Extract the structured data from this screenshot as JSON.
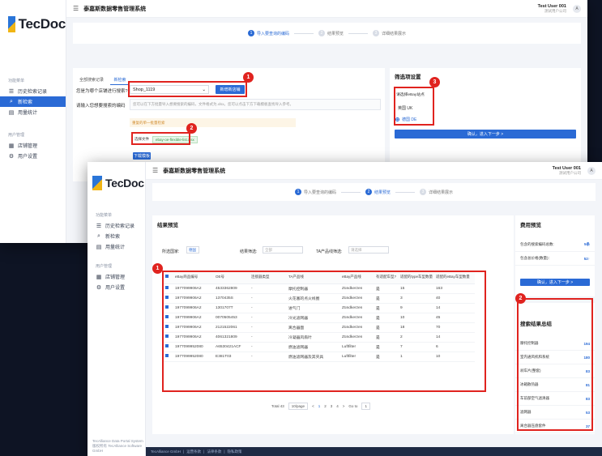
{
  "brand": {
    "logo_text": "TecDoc",
    "footer_line1": "TecAlliance Data Portal System",
    "footer_line2": "版权所有 TecAlliance Software GmbH"
  },
  "topbar": {
    "app_title": "泰嘉斯数据零售管理系统",
    "user_name": "Test User 001",
    "user_org": "测试用户公司",
    "avatar": "A"
  },
  "nav": {
    "group1": "功能菜单",
    "items1": [
      "历史检索记录",
      "新检索",
      "用量统计"
    ],
    "group2": "用户管理",
    "items2": [
      "店铺管理",
      "用户设置"
    ]
  },
  "steps": [
    {
      "num": "1",
      "label": "导入要查询的编码"
    },
    {
      "num": "2",
      "label": "结果预览"
    },
    {
      "num": "3",
      "label": "详细结果展示"
    }
  ],
  "window1": {
    "tabs": [
      "全部搜索记录",
      "新检索"
    ],
    "label_search": "您是为哪个店铺进行搜索?",
    "shop_value": "Shop_1119",
    "btn_add_shop": "新增新店铺",
    "label_codes": "请输入您想要搜索的编码",
    "codes_hint": "您可以在下方批量导入想要搜索的编码，文件格式为.xlsx。您可以点击下方下载模板查找导入参考。",
    "warn": "重复的单一批量检索",
    "upload_label": "选择文件",
    "upload_file": "ebay-oe-flexible-list.xlsx",
    "btn_download": "下载模板",
    "filter_title": "筛选项设置",
    "filter_site_label": "请选择eBay站点",
    "site_uk": "英国 UK",
    "site_de": "德国 DE",
    "btn_confirm": "确认，进入下一步 >",
    "badges": [
      "1",
      "2",
      "3"
    ]
  },
  "window2": {
    "section_title": "结果预览",
    "filter_country_label": "所选国家:",
    "filter_country_value": "德国",
    "filter_result_label": "结果筛选:",
    "filter_result_value": "全部",
    "filter_ta_label": "TA产品线筛选:",
    "filter_ta_value": "请选择",
    "columns": [
      "eBay商品编号",
      "OE号",
      "连接器类型",
      "TA产品线",
      "eBay产品线",
      "有适配车型?",
      "适配的type车型数量",
      "适配的eBay车型数量"
    ],
    "rows": [
      [
        "1977099906A2",
        "4533362809",
        "-",
        "摩托控制器",
        "Zündkerzen",
        "是",
        "15",
        "163"
      ],
      [
        "1977099906A2",
        "1370435S",
        "-",
        "火花塞的点火线圈",
        "Zündkerzen",
        "是",
        "3",
        "40"
      ],
      [
        "1977099906A2",
        "1301707T",
        "-",
        "进气门",
        "Zündkerzen",
        "是",
        "9",
        "14"
      ],
      [
        "1977099906A2",
        "0070505453",
        "-",
        "冷光滤网器",
        "Zündkerzen",
        "是",
        "10",
        "45"
      ],
      [
        "1977099906A2",
        "2121522061",
        "-",
        "离合器面",
        "Zündkerzen",
        "是",
        "18",
        "70"
      ],
      [
        "1977099906A2",
        "4061321809",
        "-",
        "冷凝器风扇叶",
        "Zündkerzen",
        "是",
        "2",
        "14"
      ],
      [
        "1977099952080",
        "A6530421ACF",
        "-",
        "燃油滤网器",
        "Luftfilter",
        "是",
        "7",
        "6"
      ],
      [
        "1977099952080",
        "E381T03",
        "-",
        "燃油滤网器及其夹具",
        "Luftfilter",
        "是",
        "1",
        "10"
      ]
    ],
    "pager": {
      "total": "Total 43",
      "per_page": "10/page",
      "prev": "<",
      "pages": [
        "1",
        "2",
        "3",
        "4"
      ],
      "next": ">",
      "goto": "Go to",
      "goto_value": "1"
    },
    "cost_title": "费用预览",
    "cost_rows": [
      {
        "label": "包含的搜索编码总数:",
        "value": "5条"
      },
      {
        "label": "包含总价格(数量)：",
        "value": "52↑"
      }
    ],
    "btn_confirm": "确认，进入下一步 >",
    "stats_title": "搜索结果总结",
    "stats": [
      {
        "label": "摩托控制器",
        "value": "194"
      },
      {
        "label": "室内通风机和系统",
        "value": "180"
      },
      {
        "label": "刹车片(整套)",
        "value": "83"
      },
      {
        "label": "冰箱散热器",
        "value": "81"
      },
      {
        "label": "车前部空气滤清器",
        "value": "83"
      },
      {
        "label": "滤网器",
        "value": "53"
      },
      {
        "label": "离合器压盘套件",
        "value": "37"
      }
    ],
    "bottom_links": [
      "TecAlliance GmbH",
      "|",
      "运营条款",
      "|",
      "法律条款",
      "|",
      "隐私政策"
    ],
    "badges": [
      "1",
      "2"
    ]
  }
}
